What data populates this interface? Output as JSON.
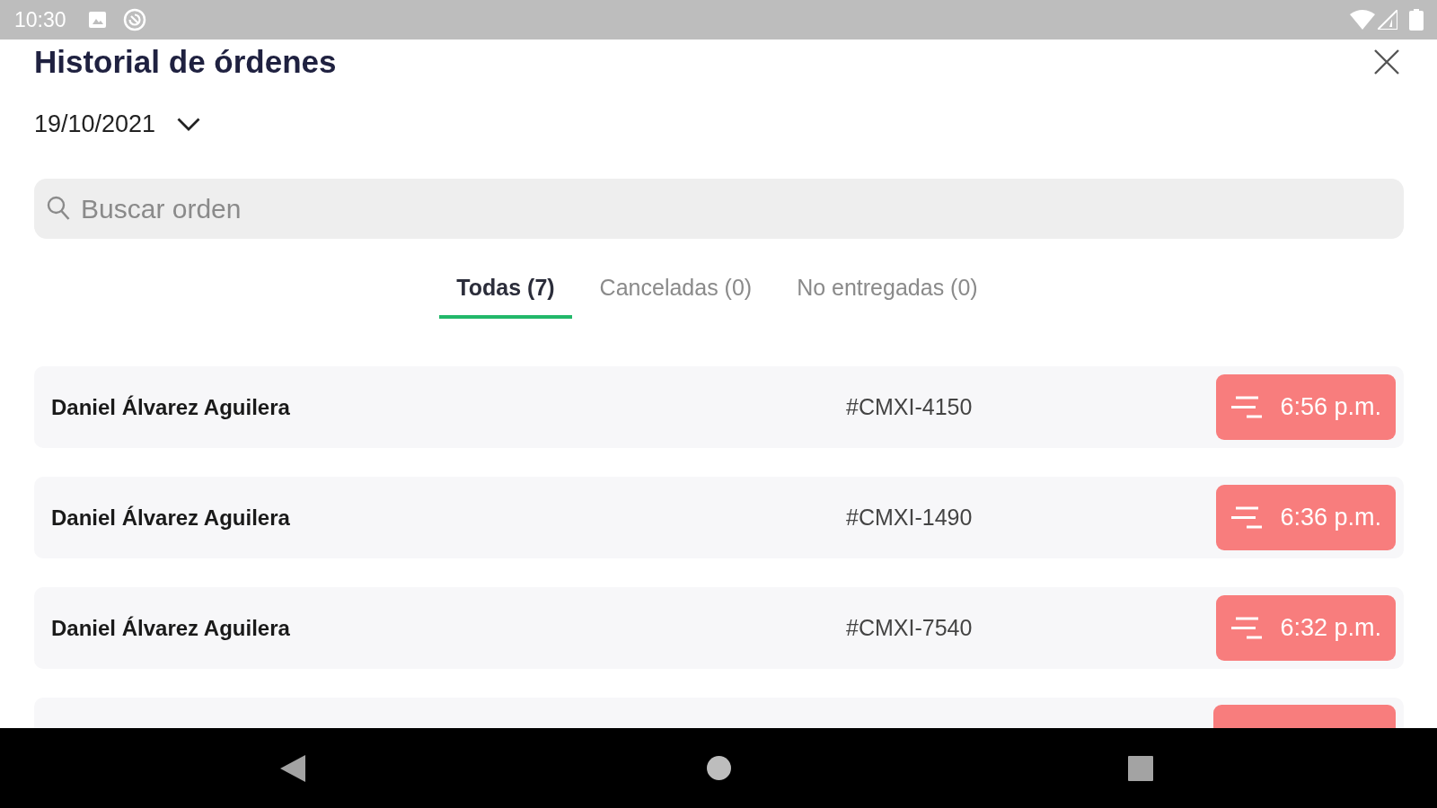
{
  "status_bar": {
    "time": "10:30"
  },
  "header": {
    "title": "Historial de órdenes",
    "date": "19/10/2021"
  },
  "search": {
    "placeholder": "Buscar orden"
  },
  "tabs": [
    {
      "label": "Todas (7)",
      "selected": true
    },
    {
      "label": "Canceladas (0)",
      "selected": false
    },
    {
      "label": "No entregadas (0)",
      "selected": false
    }
  ],
  "orders": [
    {
      "kind": "order",
      "customer": "Daniel Álvarez Aguilera",
      "order_number": "#CMXI-4150",
      "time": "6:56 p.m."
    },
    {
      "kind": "order",
      "customer": "Daniel Álvarez Aguilera",
      "order_number": "#CMXI-1490",
      "time": "6:36 p.m."
    },
    {
      "kind": "order",
      "customer": "Daniel Álvarez Aguilera",
      "order_number": "#CMXI-7540",
      "time": "6:32 p.m."
    },
    {
      "kind": "cut_off"
    }
  ]
}
